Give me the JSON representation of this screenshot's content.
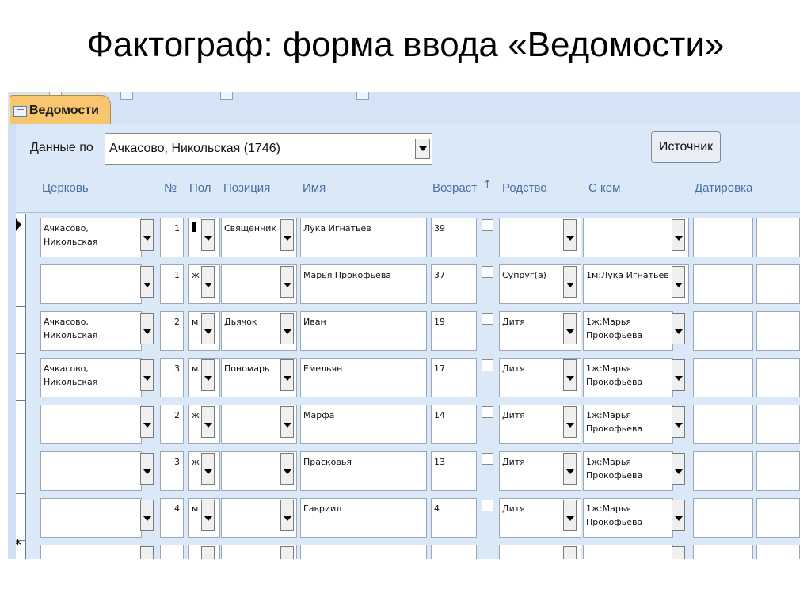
{
  "slide": {
    "title": "Фактограф: форма ввода «Ведомости»"
  },
  "tab": {
    "label": "Ведомости",
    "icon": "form-icon"
  },
  "filter": {
    "label": "Данные по",
    "value": "Ачкасово, Никольская (1746)"
  },
  "source_button": {
    "label": "Источник"
  },
  "columns": {
    "church": "Церковь",
    "num": "№",
    "sex": "Пол",
    "position": "Позиция",
    "name": "Имя",
    "age": "Возраст",
    "kin": "Родство",
    "with": "С кем",
    "dating": "Датировка"
  },
  "rows": [
    {
      "church": "Ачкасово, Никольская",
      "num": "1",
      "sex": "",
      "position": "Священник",
      "name": "Лука Игнатьев",
      "age": "39",
      "kin": "",
      "with": ""
    },
    {
      "church": "",
      "num": "1",
      "sex": "ж",
      "position": "",
      "name": "Марья Прокофьева",
      "age": "37",
      "kin": "Супруг(а)",
      "with": "1м:Лука Игнатьев"
    },
    {
      "church": "Ачкасово, Никольская",
      "num": "2",
      "sex": "м",
      "position": "Дьячок",
      "name": "Иван",
      "age": "19",
      "kin": "Дитя",
      "with": "1ж:Марья Прокофьева"
    },
    {
      "church": "Ачкасово, Никольская",
      "num": "3",
      "sex": "м",
      "position": "Пономарь",
      "name": "Емельян",
      "age": "17",
      "kin": "Дитя",
      "with": "1ж:Марья Прокофьева"
    },
    {
      "church": "",
      "num": "2",
      "sex": "ж",
      "position": "",
      "name": "Марфа",
      "age": "14",
      "kin": "Дитя",
      "with": "1ж:Марья Прокофьева"
    },
    {
      "church": "",
      "num": "3",
      "sex": "ж",
      "position": "",
      "name": "Прасковья",
      "age": "13",
      "kin": "Дитя",
      "with": "1ж:Марья Прокофьева"
    },
    {
      "church": "",
      "num": "4",
      "sex": "м",
      "position": "",
      "name": "Гавриил",
      "age": "4",
      "kin": "Дитя",
      "with": "1ж:Марья Прокофьева"
    }
  ],
  "new_row_marker": "*"
}
